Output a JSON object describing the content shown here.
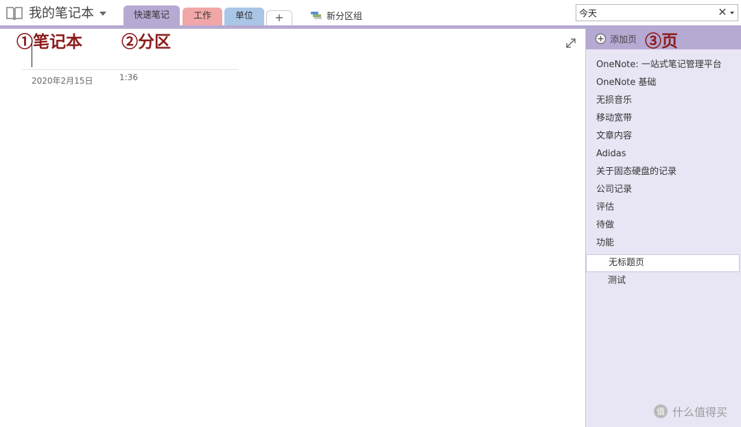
{
  "notebook": {
    "title": "我的笔记本",
    "icon": "notebook-icon"
  },
  "sections": {
    "tabs": [
      {
        "label": "快速笔记",
        "color": "#b6a9d2",
        "active": true
      },
      {
        "label": "工作",
        "color": "#f1a7a7",
        "active": false
      },
      {
        "label": "单位",
        "color": "#a9c6e6",
        "active": false
      }
    ],
    "add_label": "+",
    "new_group_label": "新分区组"
  },
  "search": {
    "value": "今天",
    "clear_label": "✕"
  },
  "annotations": {
    "notebook": "①笔记本",
    "section": "②分区",
    "page": "③页"
  },
  "page": {
    "date": "2020年2月15日",
    "time": "1:36"
  },
  "pages_pane": {
    "add_page_label": "添加页",
    "items": [
      {
        "label": "OneNote: 一站式笔记管理平台",
        "sub": false,
        "selected": false
      },
      {
        "label": "OneNote 基础",
        "sub": false,
        "selected": false
      },
      {
        "label": "无损音乐",
        "sub": false,
        "selected": false
      },
      {
        "label": "移动宽带",
        "sub": false,
        "selected": false
      },
      {
        "label": "文章内容",
        "sub": false,
        "selected": false
      },
      {
        "label": "Adidas",
        "sub": false,
        "selected": false
      },
      {
        "label": "关于固态硬盘的记录",
        "sub": false,
        "selected": false
      },
      {
        "label": "公司记录",
        "sub": false,
        "selected": false
      },
      {
        "label": "评估",
        "sub": false,
        "selected": false
      },
      {
        "label": "待做",
        "sub": false,
        "selected": false
      },
      {
        "label": "功能",
        "sub": false,
        "selected": false
      },
      {
        "label": "无标题页",
        "sub": true,
        "selected": true
      },
      {
        "label": "测试",
        "sub": true,
        "selected": false
      }
    ]
  },
  "watermark": {
    "label": "什么值得买"
  },
  "colors": {
    "accent": "#b6a9d2",
    "pane_bg": "#e8e5f4",
    "annotation": "#8b1c1c"
  }
}
